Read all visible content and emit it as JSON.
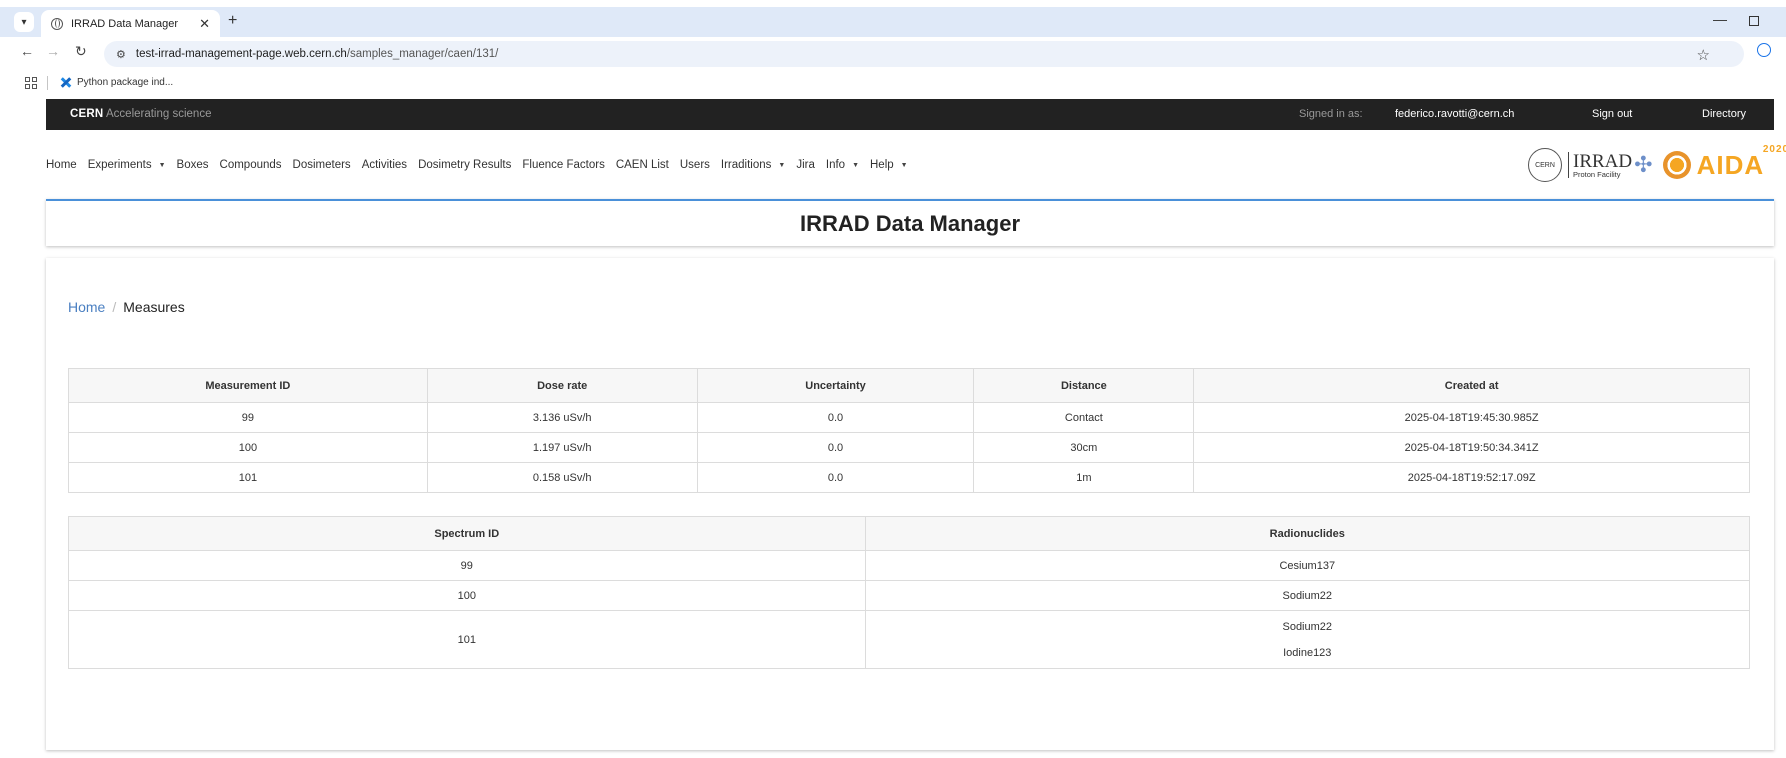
{
  "browser": {
    "tab_title": "IRRAD Data Manager",
    "url_host": "test-irrad-management-page.web.cern.ch",
    "url_path": "/samples_manager/caen/131/",
    "bookmark": "Python package ind..."
  },
  "cern_bar": {
    "brand": "CERN",
    "tagline": "Accelerating science",
    "signed_in_label": "Signed in as:",
    "user": "federico.ravotti@cern.ch",
    "sign_out": "Sign out",
    "directory": "Directory"
  },
  "nav": [
    {
      "label": "Home",
      "dropdown": false
    },
    {
      "label": "Experiments",
      "dropdown": true
    },
    {
      "label": "Boxes",
      "dropdown": false
    },
    {
      "label": "Compounds",
      "dropdown": false
    },
    {
      "label": "Dosimeters",
      "dropdown": false
    },
    {
      "label": "Activities",
      "dropdown": false
    },
    {
      "label": "Dosimetry Results",
      "dropdown": false
    },
    {
      "label": "Fluence Factors",
      "dropdown": false
    },
    {
      "label": "CAEN List",
      "dropdown": false
    },
    {
      "label": "Users",
      "dropdown": false
    },
    {
      "label": "Irraditions",
      "dropdown": true
    },
    {
      "label": "Jira",
      "dropdown": false
    },
    {
      "label": "Info",
      "dropdown": true
    },
    {
      "label": "Help",
      "dropdown": true
    }
  ],
  "logos": {
    "cern": "CERN",
    "irrad": "IRRAD",
    "irrad_sub": "Proton Facility",
    "aida": "AIDA",
    "aida_year": "2020"
  },
  "page_title": "IRRAD Data Manager",
  "breadcrumb": {
    "home": "Home",
    "separator": "/",
    "current": "Measures"
  },
  "measures_table": {
    "headers": [
      "Measurement ID",
      "Dose rate",
      "Uncertainty",
      "Distance",
      "Created at"
    ],
    "rows": [
      [
        "99",
        "3.136 uSv/h",
        "0.0",
        "Contact",
        "2025-04-18T19:45:30.985Z"
      ],
      [
        "100",
        "1.197 uSv/h",
        "0.0",
        "30cm",
        "2025-04-18T19:50:34.341Z"
      ],
      [
        "101",
        "0.158 uSv/h",
        "0.0",
        "1m",
        "2025-04-18T19:52:17.09Z"
      ]
    ]
  },
  "spectra_table": {
    "headers": [
      "Spectrum ID",
      "Radionuclides"
    ],
    "rows": [
      {
        "id": "99",
        "nuclides": [
          "Cesium137"
        ]
      },
      {
        "id": "100",
        "nuclides": [
          "Sodium22"
        ]
      },
      {
        "id": "101",
        "nuclides": [
          "Sodium22",
          "Iodine123"
        ]
      }
    ]
  }
}
